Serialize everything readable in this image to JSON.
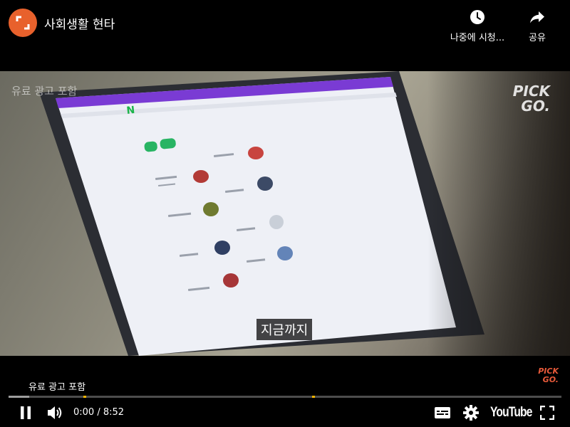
{
  "header": {
    "title": "사회생활 현타",
    "watch_later_label": "나중에 시청...",
    "share_label": "공유",
    "icons": {
      "channel": "pickgo-channel-avatar",
      "watch_later": "clock-icon",
      "share": "share-arrow-icon"
    }
  },
  "video": {
    "paid_promo_overlay": "유료 광고 포함",
    "caption": "지금까지",
    "brand_logo": {
      "line1": "PICK",
      "line2": "GO."
    }
  },
  "controls": {
    "paid_promo_label": "유료 광고 포함",
    "current_time": "0:00",
    "duration": "8:52",
    "time_display": "0:00 / 8:52",
    "progress_played": 0,
    "progress_buffered": 0.038,
    "youtube_label": "YouTube",
    "mini_logo": {
      "line1": "PICK",
      "line2": "GO."
    },
    "icons": [
      "pause-icon",
      "volume-icon",
      "subtitles-icon",
      "settings-gear-icon",
      "fullscreen-icon"
    ]
  },
  "colors": {
    "brand_orange": "#e8612c",
    "ad_marker": "#f6b400",
    "background": "#000000"
  }
}
